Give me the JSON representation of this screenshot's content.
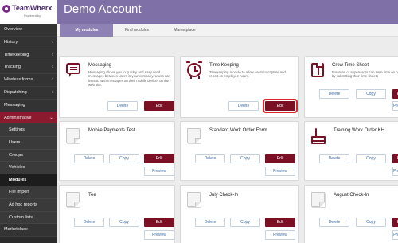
{
  "brand": {
    "name": "TeamWherx",
    "powered_by": "Powered by"
  },
  "header": {
    "title": "Demo Account"
  },
  "tabs": [
    {
      "label": "My modules",
      "active": true
    },
    {
      "label": "Find modules",
      "active": false
    },
    {
      "label": "Marketplace",
      "active": false
    }
  ],
  "sidebar": {
    "items": [
      {
        "label": "Overview",
        "chevron": ""
      },
      {
        "label": "History",
        "chevron": "›"
      },
      {
        "label": "Timekeeping",
        "chevron": "›"
      },
      {
        "label": "Tracking",
        "chevron": "›"
      },
      {
        "label": "Wireless forms",
        "chevron": "›"
      },
      {
        "label": "Dispatching",
        "chevron": "›"
      },
      {
        "label": "Messaging",
        "chevron": ""
      },
      {
        "label": "Administrative",
        "chevron": "⌄"
      }
    ],
    "sub_items": [
      {
        "label": "Settings"
      },
      {
        "label": "Users"
      },
      {
        "label": "Groups"
      },
      {
        "label": "Vehicles"
      },
      {
        "label": "Modules",
        "active": true
      },
      {
        "label": "File import"
      },
      {
        "label": "Ad hoc reports"
      },
      {
        "label": "Custom lists"
      }
    ],
    "bottom_items": [
      {
        "label": "Marketplace",
        "chevron": ""
      }
    ]
  },
  "buttons": {
    "delete": "Delete",
    "copy": "Copy",
    "edit": "Edit",
    "preview": "Preview"
  },
  "cards": [
    {
      "title": "Messaging",
      "icon": "message-icon",
      "description": "Messaging allows you to quickly and easy send messages between users in your company. Users can interact with messages on their mobile device, on the web site."
    },
    {
      "title": "Time Keeping",
      "icon": "alarm-clock-icon",
      "description": "Timekeeping module to allow users to capture and report on employee hours."
    },
    {
      "title": "Crew Time Sheet",
      "icon": "shirt-icon",
      "description": "Foreman or supervisors can save time on paper by submitting their time sheets"
    },
    {
      "title": "Mobile Payments Test",
      "icon": "document-icon",
      "description": ""
    },
    {
      "title": "Standard Work Order Form",
      "icon": "document-icon",
      "description": ""
    },
    {
      "title": "Training Work Order KH",
      "icon": "cake-icon",
      "description": ""
    },
    {
      "title": "Tee",
      "icon": "document-icon",
      "description": ""
    },
    {
      "title": "July Check-In",
      "icon": "document-icon",
      "description": ""
    },
    {
      "title": "August Check-In",
      "icon": "document-icon",
      "description": ""
    }
  ]
}
